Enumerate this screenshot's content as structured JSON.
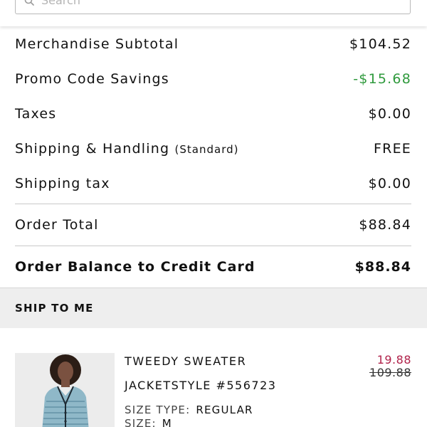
{
  "search": {
    "placeholder": "Search",
    "icon": "search-icon"
  },
  "summary": {
    "rows": [
      {
        "label": "Merchandise Subtotal",
        "value": "$104.52"
      },
      {
        "label": "Promo Code Savings",
        "value": "-$15.68"
      },
      {
        "label": "Taxes",
        "value": "$0.00"
      },
      {
        "label": "Shipping & Handling",
        "sublabel": "(Standard)",
        "value": "FREE"
      },
      {
        "label": "Shipping tax",
        "value": "$0.00"
      }
    ],
    "order_total": {
      "label": "Order Total",
      "value": "$88.84"
    },
    "balance": {
      "label": "Order Balance to Credit Card",
      "value": "$88.84"
    }
  },
  "ship_section": {
    "title": "SHIP TO ME"
  },
  "item": {
    "name": "TWEEDY SWEATER",
    "style_line": "JACKETSTYLE #556723",
    "size_type_label": "SIZE TYPE:",
    "size_type_value": "REGULAR",
    "size_label": "SIZE:",
    "size_value": "M",
    "sale_price": "19.88",
    "original_price": "109.88"
  },
  "colors": {
    "savings": "#2f9a3d",
    "sale_price": "#b0224a",
    "band_bg": "#eeeeee"
  }
}
